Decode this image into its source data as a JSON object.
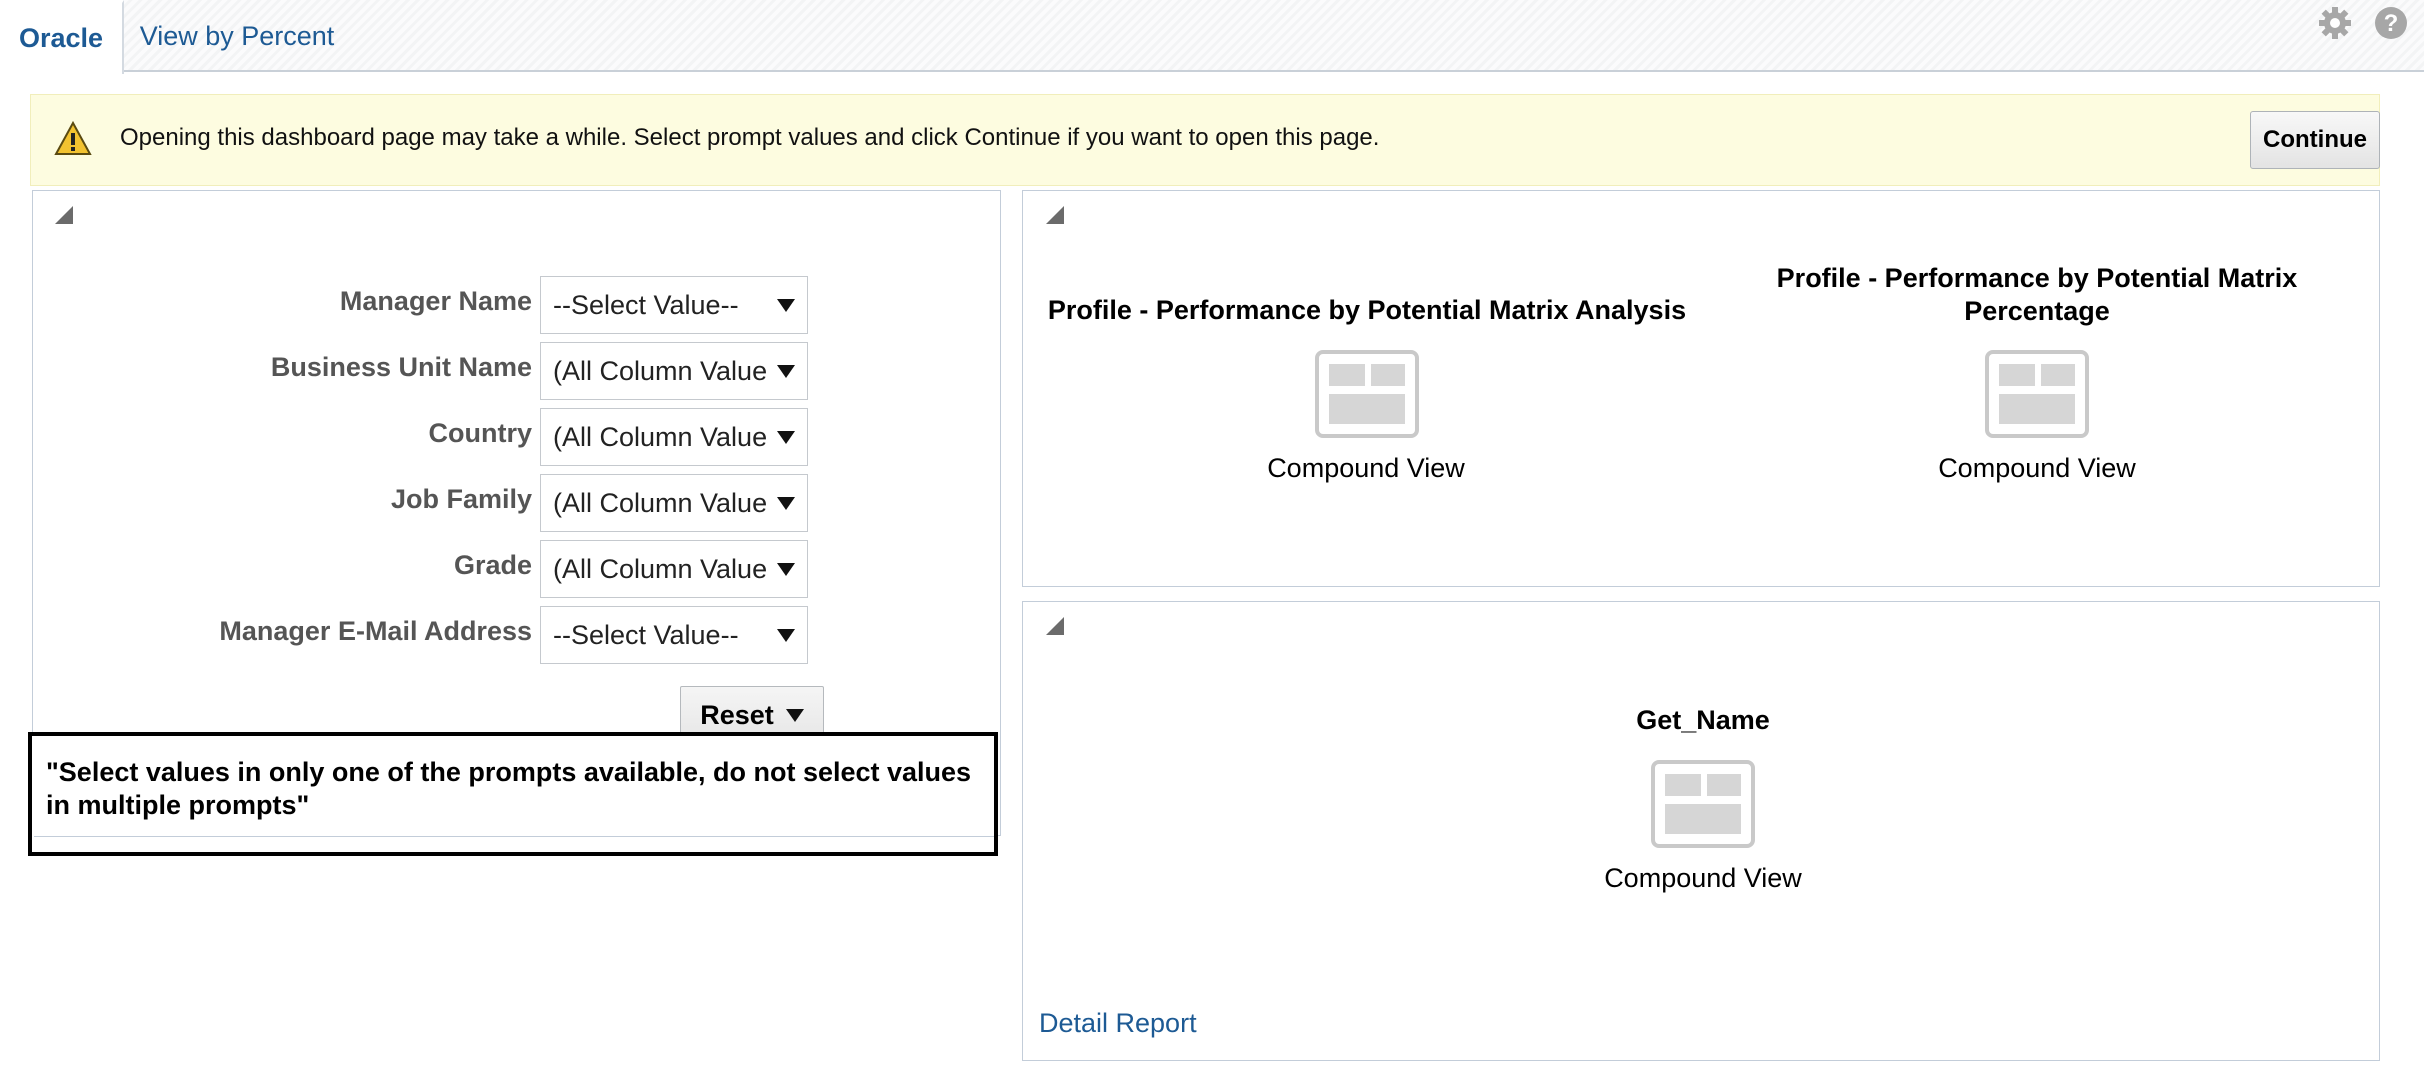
{
  "tabs": [
    {
      "label": "Oracle",
      "active": true
    },
    {
      "label": "View by Percent",
      "active": false
    }
  ],
  "header_icons": [
    "gear-icon",
    "help-icon"
  ],
  "banner": {
    "icon": "warning-icon",
    "message": "Opening this dashboard page may take a while. Select prompt values and click Continue if you want to open this page.",
    "continue_label": "Continue"
  },
  "prompts": [
    {
      "label": "Manager Name",
      "value": "--Select Value--"
    },
    {
      "label": "Business Unit Name",
      "value": "(All Column Values)"
    },
    {
      "label": "Country",
      "value": "(All Column Values)"
    },
    {
      "label": "Job Family",
      "value": "(All Column Values)"
    },
    {
      "label": "Grade",
      "value": "(All Column Values)"
    },
    {
      "label": "Manager E-Mail Address",
      "value": "--Select Value--"
    }
  ],
  "reset_label": "Reset",
  "note": "\"Select values in only one of the prompts available, do not select values in multiple prompts\"",
  "views": [
    {
      "title": "Profile - Performance by Potential Matrix Analysis",
      "label": "Compound View"
    },
    {
      "title": "Profile - Performance by Potential Matrix Percentage",
      "label": "Compound View"
    },
    {
      "title": "Get_Name",
      "label": "Compound View"
    }
  ],
  "detail_link": "Detail Report",
  "colors": {
    "link": "#1d5a94",
    "banner_bg": "#fdfce0",
    "panel_border": "#c3cdd9"
  }
}
